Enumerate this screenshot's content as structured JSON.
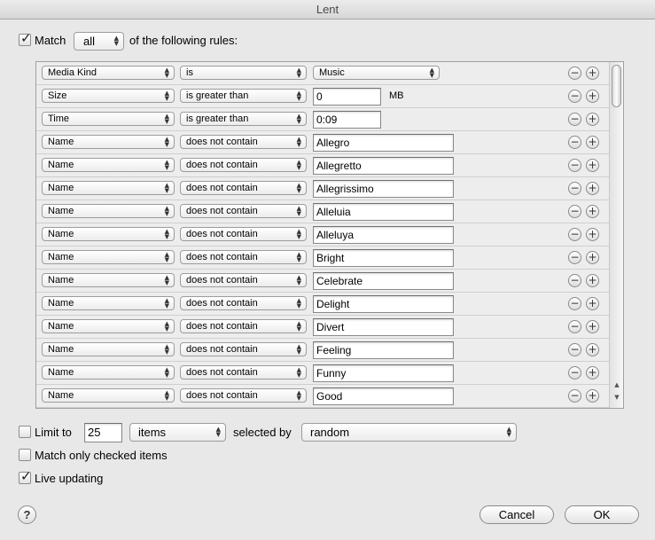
{
  "window": {
    "title": "Lent"
  },
  "match": {
    "checked": true,
    "label": "Match",
    "mode": "all",
    "suffix": "of the following rules:"
  },
  "rules": [
    {
      "field": "Media Kind",
      "op": "is",
      "value": "Music",
      "value_kind": "popup",
      "unit": ""
    },
    {
      "field": "Size",
      "op": "is greater than",
      "value": "0",
      "value_kind": "short",
      "unit": "MB"
    },
    {
      "field": "Time",
      "op": "is greater than",
      "value": "0:09",
      "value_kind": "short",
      "unit": ""
    },
    {
      "field": "Name",
      "op": "does not contain",
      "value": "Allegro",
      "value_kind": "text",
      "unit": ""
    },
    {
      "field": "Name",
      "op": "does not contain",
      "value": "Allegretto",
      "value_kind": "text",
      "unit": ""
    },
    {
      "field": "Name",
      "op": "does not contain",
      "value": "Allegrissimo",
      "value_kind": "text",
      "unit": ""
    },
    {
      "field": "Name",
      "op": "does not contain",
      "value": "Alleluia",
      "value_kind": "text",
      "unit": ""
    },
    {
      "field": "Name",
      "op": "does not contain",
      "value": "Alleluya",
      "value_kind": "text",
      "unit": ""
    },
    {
      "field": "Name",
      "op": "does not contain",
      "value": "Bright",
      "value_kind": "text",
      "unit": ""
    },
    {
      "field": "Name",
      "op": "does not contain",
      "value": "Celebrate",
      "value_kind": "text",
      "unit": ""
    },
    {
      "field": "Name",
      "op": "does not contain",
      "value": "Delight",
      "value_kind": "text",
      "unit": ""
    },
    {
      "field": "Name",
      "op": "does not contain",
      "value": "Divert",
      "value_kind": "text",
      "unit": ""
    },
    {
      "field": "Name",
      "op": "does not contain",
      "value": "Feeling",
      "value_kind": "text",
      "unit": ""
    },
    {
      "field": "Name",
      "op": "does not contain",
      "value": "Funny",
      "value_kind": "text",
      "unit": ""
    },
    {
      "field": "Name",
      "op": "does not contain",
      "value": "Good",
      "value_kind": "text",
      "unit": ""
    }
  ],
  "rule_buttons": {
    "remove": "−",
    "add": "+"
  },
  "limit": {
    "checked": false,
    "label": "Limit to",
    "value": "25",
    "unit": "items",
    "selected_by_label": "selected by",
    "selected_by": "random"
  },
  "match_checked": {
    "checked": false,
    "label": "Match only checked items"
  },
  "live_updating": {
    "checked": true,
    "label": "Live updating"
  },
  "buttons": {
    "help": "?",
    "cancel": "Cancel",
    "ok": "OK"
  },
  "icons": {
    "popup_arrows": "updown-arrows-icon",
    "remove": "minus-circle-icon",
    "add": "plus-circle-icon",
    "help": "help-icon",
    "checkbox": "checkmark-icon"
  }
}
